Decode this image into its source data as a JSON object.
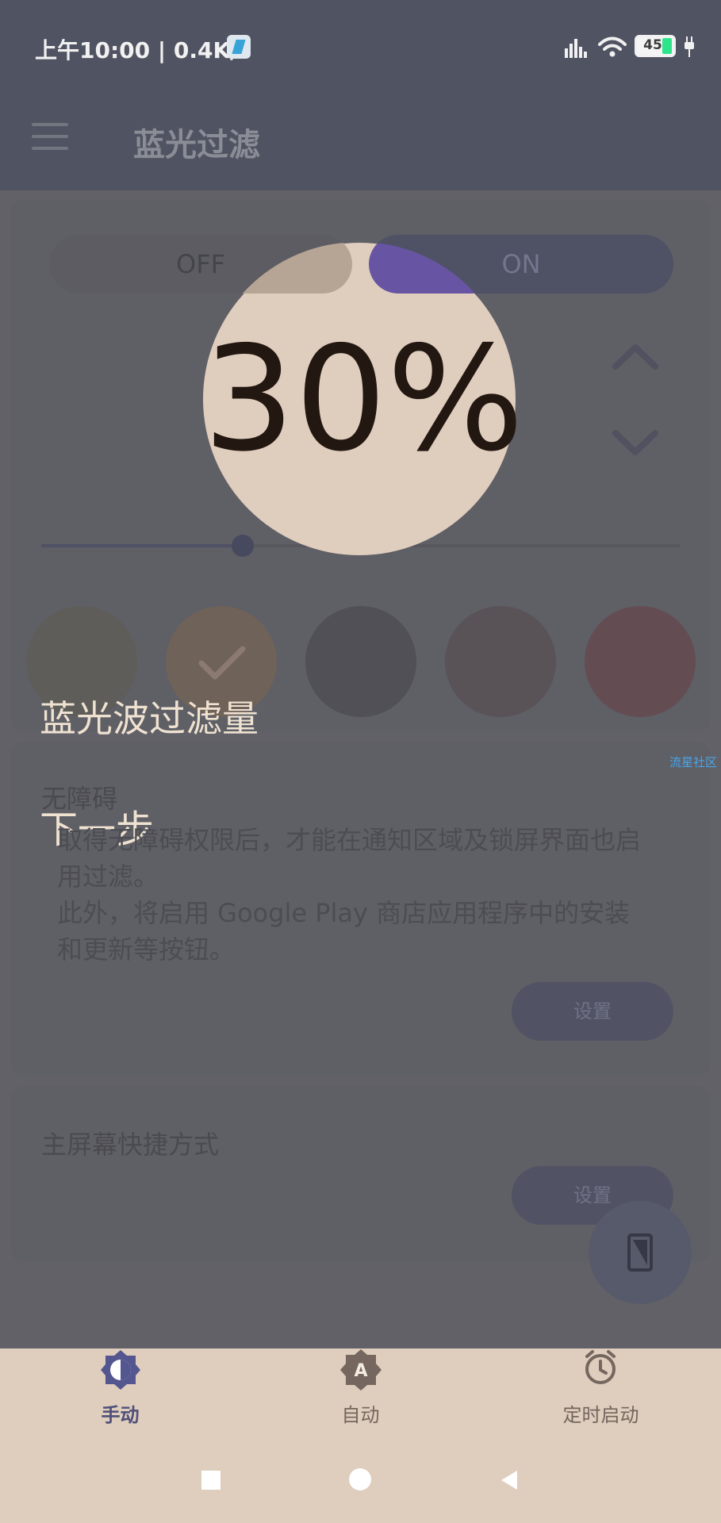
{
  "status_bar": {
    "time_speed": "上午10:00 | 0.4K/s",
    "battery_percent": "45"
  },
  "app_bar": {
    "title": "蓝光过滤"
  },
  "filter_toggle": {
    "off_label": "OFF",
    "on_label": "ON",
    "value": "30%"
  },
  "overlay": {
    "label": "蓝光波过滤量",
    "next_step": "下一步",
    "watermark": "流星社区"
  },
  "accessibility_card": {
    "title": "无障碍",
    "body_lines": [
      "取得无障碍权限后，才能在通知区域及锁屏界面也启",
      "用过滤。",
      "此外，将启用 Google Play 商店应用程序中的安装",
      "和更新等按钮。"
    ],
    "button_label": "设置"
  },
  "shortcut_card": {
    "title": "主屏幕快捷方式",
    "button_label": "设置"
  },
  "bottom_tabs": {
    "manual": "手动",
    "auto": "自动",
    "timer": "定时启动"
  },
  "colors": {
    "status_bar_bg": "#505361",
    "overlay_text": "#efe2d1",
    "focus_circle_bg": "#dfcdbd",
    "accent_purple": "#6754a3",
    "watermark_blue": "#4aa5e8",
    "tab_active": "#4f5079",
    "tab_inactive": "#73665f"
  },
  "icons": {
    "menu": "menu-icon",
    "signal": "signal-icon",
    "wifi": "wifi-icon",
    "battery": "battery-icon",
    "plug": "plug-icon",
    "up": "chevron-up-icon",
    "down": "chevron-down-icon",
    "check": "check-icon",
    "phone": "phone-icon",
    "manual": "brightness-icon",
    "auto": "auto-brightness-icon",
    "timer": "alarm-icon",
    "nav_home": "home-nav-icon",
    "nav_recents": "recents-nav-icon",
    "nav_back": "back-nav-icon"
  }
}
